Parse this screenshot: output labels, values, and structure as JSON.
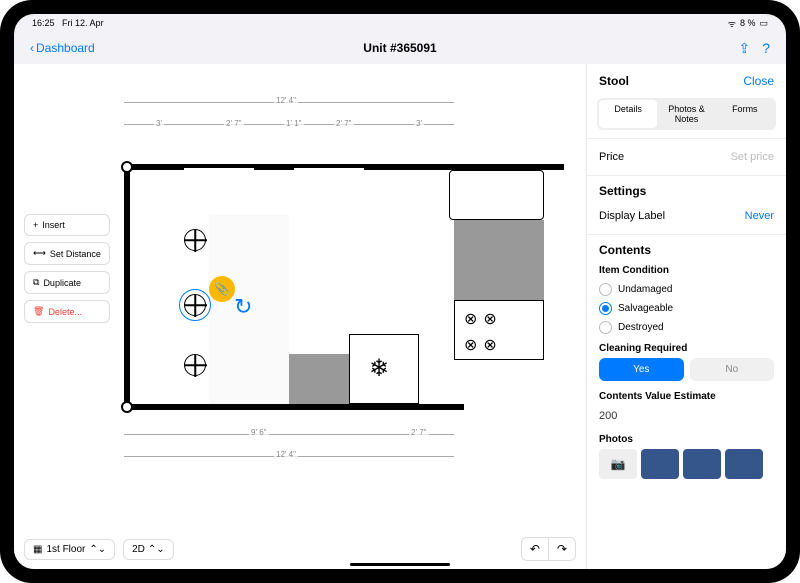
{
  "statusbar": {
    "time": "16:25",
    "date": "Fri 12. Apr",
    "battery": "8 %"
  },
  "nav": {
    "back": "Dashboard",
    "title": "Unit #365091"
  },
  "tools": {
    "insert": "Insert",
    "setDistance": "Set Distance",
    "duplicate": "Duplicate",
    "delete": "Delete..."
  },
  "bottom": {
    "floor": "1st Floor",
    "view": "2D"
  },
  "dims": {
    "top_total": "12' 4\"",
    "top_a": "3'",
    "top_b": "2' 7\"",
    "top_c": "1' 1\"",
    "top_d": "2' 7\"",
    "top_e": "3'",
    "bot_a": "9' 6\"",
    "bot_b": "2' 7\"",
    "bot_total": "12' 4\""
  },
  "sidebar": {
    "title": "Stool",
    "close": "Close",
    "tabs": {
      "details": "Details",
      "photos": "Photos & Notes",
      "forms": "Forms"
    },
    "price": {
      "label": "Price",
      "placeholder": "Set price"
    },
    "settings": {
      "title": "Settings",
      "displayLabel": "Display Label",
      "displayLabelValue": "Never"
    },
    "contents": {
      "title": "Contents",
      "condition": {
        "title": "Item Condition",
        "undamaged": "Undamaged",
        "salvageable": "Salvageable",
        "destroyed": "Destroyed",
        "selected": "salvageable"
      },
      "cleaning": {
        "title": "Cleaning Required",
        "yes": "Yes",
        "no": "No",
        "selected": "yes"
      },
      "estimate": {
        "title": "Contents Value Estimate",
        "value": "200"
      },
      "photos": "Photos"
    }
  }
}
